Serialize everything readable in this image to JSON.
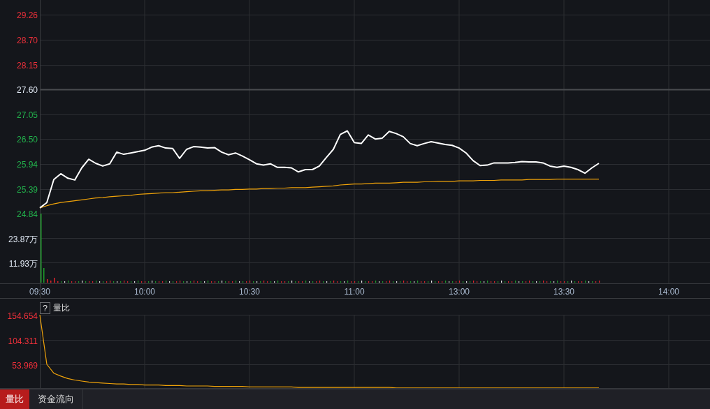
{
  "price_chart": {
    "chart_data": {
      "type": "line",
      "categories": [
        "09:30",
        null,
        null,
        null,
        null,
        null,
        null,
        null,
        null,
        null,
        null,
        null,
        null,
        null,
        null,
        "10:00",
        null,
        null,
        null,
        null,
        null,
        null,
        null,
        null,
        null,
        null,
        null,
        null,
        null,
        null,
        "10:30",
        null,
        null,
        null,
        null,
        null,
        null,
        null,
        null,
        null,
        null,
        null,
        null,
        null,
        null,
        "11:00",
        null,
        null,
        null,
        null,
        null,
        null,
        null,
        null,
        null,
        null,
        null,
        null,
        null,
        null,
        "13:00",
        null,
        null,
        null,
        null,
        null,
        null,
        null,
        null,
        null,
        null,
        null,
        null,
        null,
        null,
        "13:30",
        null,
        null,
        null,
        null,
        null,
        null,
        null,
        null,
        null,
        null,
        null,
        null,
        null,
        null,
        "14:00"
      ],
      "series": [
        {
          "color": "#ffffff",
          "values": [
            24.97,
            25.09,
            25.6,
            25.73,
            25.63,
            25.59,
            25.86,
            26.05,
            25.96,
            25.9,
            25.95,
            26.21,
            26.16,
            26.19,
            26.22,
            26.25,
            26.32,
            26.35,
            26.3,
            26.29,
            26.07,
            26.27,
            26.33,
            26.32,
            26.3,
            26.31,
            26.21,
            26.15,
            26.19,
            26.12,
            26.04,
            25.95,
            25.92,
            25.95,
            25.87,
            25.87,
            25.86,
            25.77,
            25.82,
            25.82,
            25.9,
            26.09,
            26.27,
            26.6,
            26.68,
            26.42,
            26.4,
            26.59,
            26.5,
            26.52,
            26.67,
            26.62,
            26.55,
            26.4,
            26.35,
            26.4,
            26.44,
            26.41,
            26.38,
            26.36,
            26.3,
            26.19,
            26.02,
            25.91,
            25.92,
            25.97,
            25.97,
            25.97,
            25.98,
            26.0,
            25.99,
            25.99,
            25.97,
            25.9,
            25.87,
            25.9,
            25.87,
            25.82,
            25.74,
            25.86,
            25.96,
            null,
            null,
            null,
            null,
            null,
            null,
            null,
            null,
            null,
            null
          ]
        },
        {
          "color": "#f0a30a",
          "values": [
            24.97,
            25.02,
            25.06,
            25.09,
            25.11,
            25.13,
            25.15,
            25.17,
            25.19,
            25.2,
            25.22,
            25.23,
            25.24,
            25.25,
            25.27,
            25.28,
            25.29,
            25.3,
            25.31,
            25.31,
            25.32,
            25.33,
            25.34,
            25.35,
            25.35,
            25.36,
            25.37,
            25.37,
            25.38,
            25.38,
            25.39,
            25.39,
            25.4,
            25.4,
            25.41,
            25.41,
            25.42,
            25.42,
            25.42,
            25.43,
            25.44,
            25.45,
            25.46,
            25.48,
            25.49,
            25.5,
            25.5,
            25.51,
            25.52,
            25.52,
            25.52,
            25.53,
            25.54,
            25.54,
            25.54,
            25.55,
            25.55,
            25.56,
            25.56,
            25.56,
            25.57,
            25.57,
            25.57,
            25.58,
            25.58,
            25.58,
            25.59,
            25.59,
            25.59,
            25.59,
            25.6,
            25.6,
            25.6,
            25.6,
            25.61,
            25.61,
            25.61,
            25.61,
            25.61,
            25.61,
            25.61,
            null,
            null,
            null,
            null,
            null,
            null,
            null,
            null,
            null,
            null
          ]
        }
      ],
      "ylim": [
        23.28,
        29.26
      ],
      "grid": true,
      "yticks": [
        {
          "value": 29.26,
          "label": "29.26"
        },
        {
          "value": 28.7,
          "label": "28.70"
        },
        {
          "value": 28.15,
          "label": "28.15"
        },
        {
          "value": 27.6,
          "label": "27.60"
        },
        {
          "value": 27.05,
          "label": "27.05"
        },
        {
          "value": 26.5,
          "label": "26.50"
        },
        {
          "value": 25.94,
          "label": "25.94"
        },
        {
          "value": 25.39,
          "label": "25.39"
        },
        {
          "value": 24.84,
          "label": "24.84"
        }
      ],
      "ref_lines": [
        {
          "axis": "y",
          "value": 27.6
        }
      ]
    }
  },
  "volume_axis": {
    "labels": [
      "23.87万",
      "11.93万"
    ]
  },
  "ratio_panel": {
    "help": "?",
    "chart_data": {
      "type": "line",
      "title": "量比",
      "grid": true,
      "categories": [
        null,
        null,
        null,
        null,
        null,
        null,
        null,
        null,
        null,
        null,
        null,
        null,
        null,
        null,
        null,
        null,
        null,
        null,
        null,
        null,
        null,
        null,
        null,
        null,
        null,
        null,
        null,
        null,
        null,
        null,
        null,
        null,
        null,
        null,
        null,
        null,
        null,
        null,
        null,
        null,
        null,
        null,
        null,
        null,
        null,
        null,
        null,
        null,
        null,
        null,
        null,
        null,
        null,
        null,
        null,
        null,
        null,
        null,
        null,
        null,
        null,
        null,
        null,
        null,
        null,
        null,
        null,
        null,
        null,
        null,
        null,
        null,
        null,
        null,
        null,
        null,
        null,
        null,
        null,
        null,
        null,
        null,
        null,
        null,
        null,
        null,
        null,
        null,
        null,
        null,
        null
      ],
      "series": [
        {
          "color": "#f0a30a",
          "values": [
            154.6,
            54,
            36,
            30,
            25,
            22,
            20,
            18,
            17,
            16,
            15,
            14,
            14,
            13,
            13,
            12,
            12,
            12,
            11,
            11,
            11,
            10,
            10,
            10,
            10,
            9,
            9,
            9,
            9,
            9,
            8,
            8,
            8,
            8,
            8,
            8,
            8,
            7,
            7,
            7,
            7,
            7,
            7,
            7,
            7,
            7,
            7,
            7,
            7,
            7,
            7,
            6,
            6,
            6,
            6,
            6,
            6,
            6,
            6,
            6,
            6,
            6,
            6,
            6,
            6,
            6,
            6,
            6,
            6,
            6,
            6,
            6,
            6,
            6,
            6,
            6,
            6,
            6,
            6,
            6,
            6,
            null,
            null,
            null,
            null,
            null,
            null,
            null,
            null,
            null,
            null
          ]
        }
      ],
      "ylim": [
        5.76,
        154.654
      ],
      "yticks": [
        {
          "value": 154.654,
          "label": "154.654"
        },
        {
          "value": 104.311,
          "label": "104.311"
        },
        {
          "value": 53.969,
          "label": "53.969"
        }
      ]
    }
  },
  "tabs": [
    {
      "label": "量比",
      "selected": true
    },
    {
      "label": "资金流向",
      "selected": false
    }
  ]
}
